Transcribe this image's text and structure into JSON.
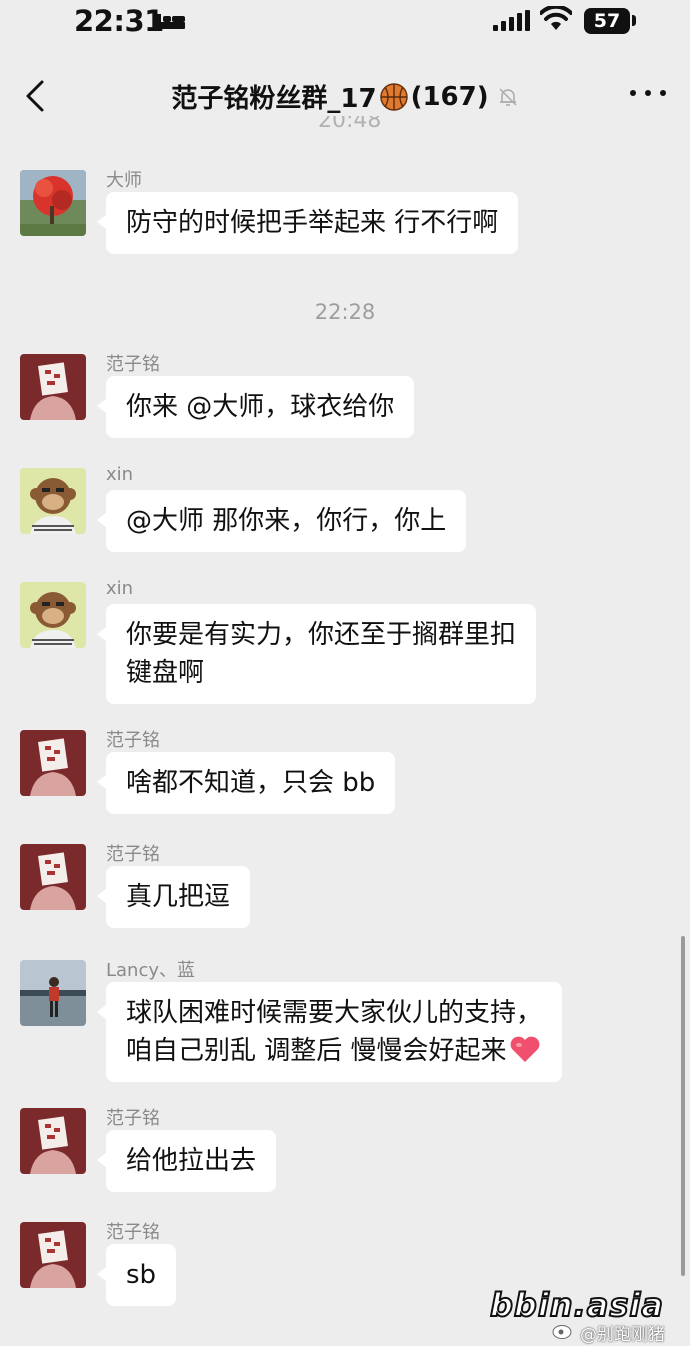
{
  "status_bar": {
    "time": "22:31",
    "battery": "57"
  },
  "header": {
    "title": "范子铭粉丝群_17",
    "member_count": "(167)"
  },
  "clipped_time": "20:48",
  "messages": [
    {
      "sender": "大师",
      "text": "防守的时候把手举起来 行不行啊"
    },
    {
      "divider": "22:28"
    },
    {
      "sender": "范子铭",
      "text": "你来 @大师，球衣给你"
    },
    {
      "sender": "xin",
      "text": "@大师 那你来，你行，你上"
    },
    {
      "sender": "xin",
      "lines": [
        "你要是有实力，你还至于搁群里扣",
        "键盘啊"
      ]
    },
    {
      "sender": "范子铭",
      "text": "啥都不知道，只会 bb"
    },
    {
      "sender": "范子铭",
      "text": "真几把逗"
    },
    {
      "sender": "Lancy、蓝",
      "lines": [
        "球队困难时候需要大家伙儿的支持，",
        "咱自己别乱 调整后 慢慢会好起来"
      ]
    },
    {
      "sender": "范子铭",
      "text": "给他拉出去"
    },
    {
      "sender": "范子铭",
      "text": "sb"
    }
  ],
  "watermark": {
    "logo": "bbin.asia",
    "weibo": "@别跑刚猪"
  }
}
